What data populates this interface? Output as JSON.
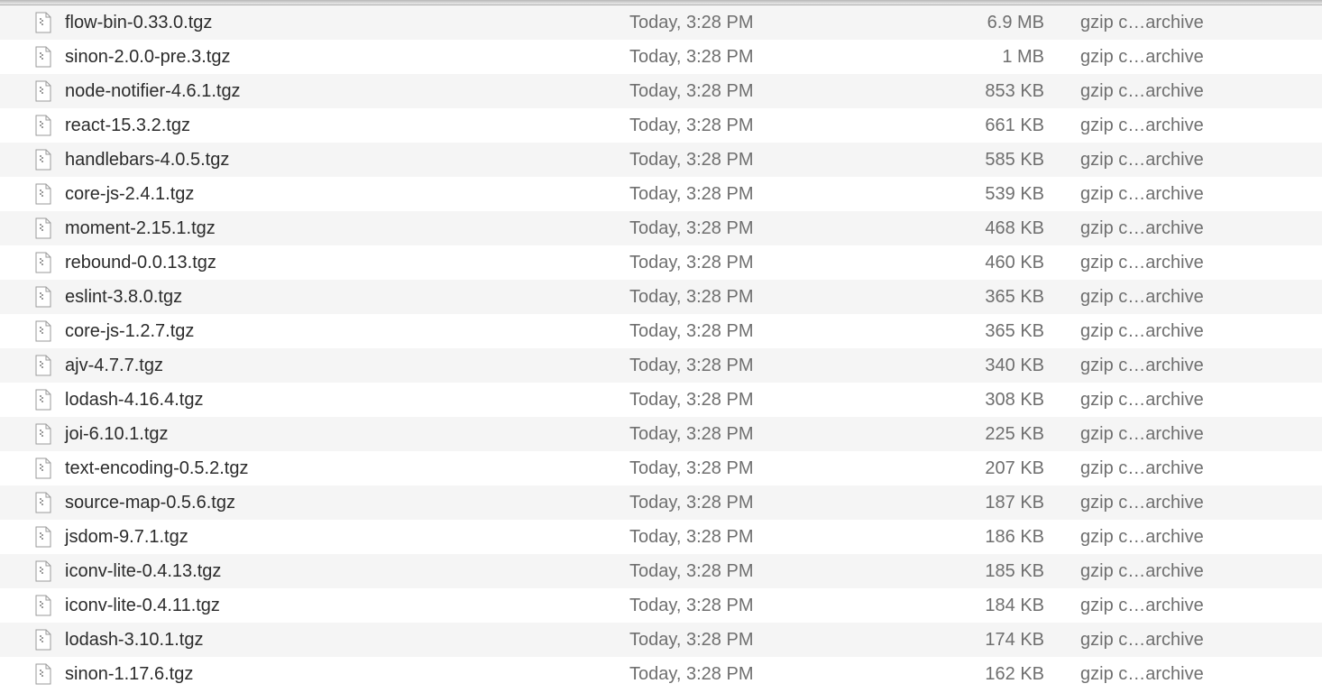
{
  "kind_left": "gzip c",
  "kind_ellipsis": "…",
  "kind_right": "archive",
  "files": [
    {
      "name": "flow-bin-0.33.0.tgz",
      "modified": "Today, 3:28 PM",
      "size": "6.9 MB"
    },
    {
      "name": "sinon-2.0.0-pre.3.tgz",
      "modified": "Today, 3:28 PM",
      "size": "1 MB"
    },
    {
      "name": "node-notifier-4.6.1.tgz",
      "modified": "Today, 3:28 PM",
      "size": "853 KB"
    },
    {
      "name": "react-15.3.2.tgz",
      "modified": "Today, 3:28 PM",
      "size": "661 KB"
    },
    {
      "name": "handlebars-4.0.5.tgz",
      "modified": "Today, 3:28 PM",
      "size": "585 KB"
    },
    {
      "name": "core-js-2.4.1.tgz",
      "modified": "Today, 3:28 PM",
      "size": "539 KB"
    },
    {
      "name": "moment-2.15.1.tgz",
      "modified": "Today, 3:28 PM",
      "size": "468 KB"
    },
    {
      "name": "rebound-0.0.13.tgz",
      "modified": "Today, 3:28 PM",
      "size": "460 KB"
    },
    {
      "name": "eslint-3.8.0.tgz",
      "modified": "Today, 3:28 PM",
      "size": "365 KB"
    },
    {
      "name": "core-js-1.2.7.tgz",
      "modified": "Today, 3:28 PM",
      "size": "365 KB"
    },
    {
      "name": "ajv-4.7.7.tgz",
      "modified": "Today, 3:28 PM",
      "size": "340 KB"
    },
    {
      "name": "lodash-4.16.4.tgz",
      "modified": "Today, 3:28 PM",
      "size": "308 KB"
    },
    {
      "name": "joi-6.10.1.tgz",
      "modified": "Today, 3:28 PM",
      "size": "225 KB"
    },
    {
      "name": "text-encoding-0.5.2.tgz",
      "modified": "Today, 3:28 PM",
      "size": "207 KB"
    },
    {
      "name": "source-map-0.5.6.tgz",
      "modified": "Today, 3:28 PM",
      "size": "187 KB"
    },
    {
      "name": "jsdom-9.7.1.tgz",
      "modified": "Today, 3:28 PM",
      "size": "186 KB"
    },
    {
      "name": "iconv-lite-0.4.13.tgz",
      "modified": "Today, 3:28 PM",
      "size": "185 KB"
    },
    {
      "name": "iconv-lite-0.4.11.tgz",
      "modified": "Today, 3:28 PM",
      "size": "184 KB"
    },
    {
      "name": "lodash-3.10.1.tgz",
      "modified": "Today, 3:28 PM",
      "size": "174 KB"
    },
    {
      "name": "sinon-1.17.6.tgz",
      "modified": "Today, 3:28 PM",
      "size": "162 KB"
    }
  ]
}
